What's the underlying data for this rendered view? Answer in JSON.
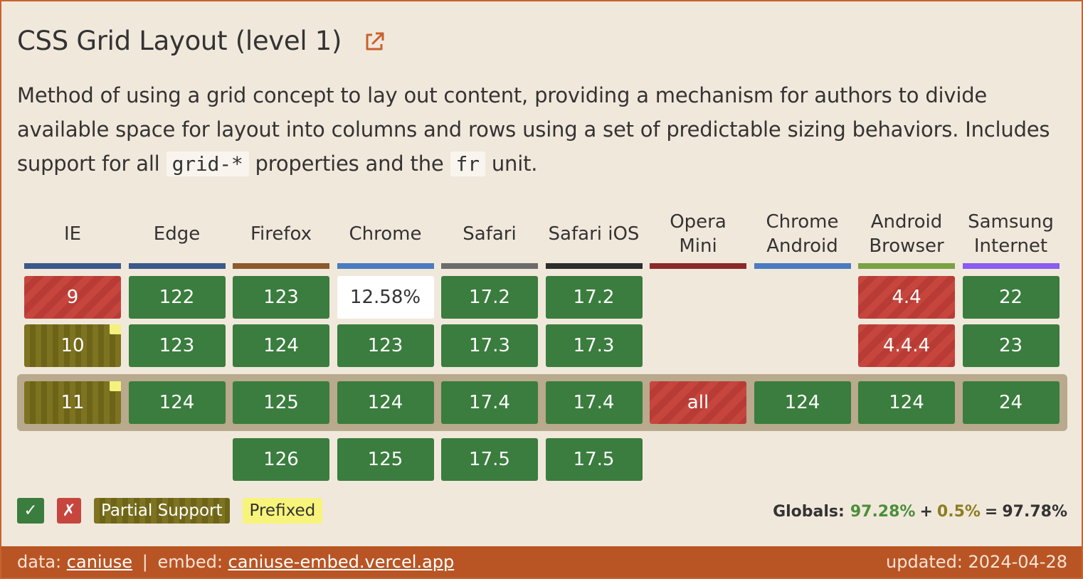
{
  "title": "CSS Grid Layout (level 1)",
  "description": {
    "part1": "Method of using a grid concept to lay out content, providing a mechanism for authors to divide available space for layout into columns and rows using a set of predictable sizing behaviors. Includes support for all ",
    "code1": "grid-*",
    "part2": " properties and the ",
    "code2": "fr",
    "part3": " unit."
  },
  "colors": {
    "supported": "#3a7d3e",
    "unsupported": "#c6463e",
    "partial": "#7d7320",
    "prefixed": "#f8f47b",
    "unknown": "#ffffff",
    "accent": "#c8622e",
    "footer": "#b95524"
  },
  "browsers": [
    {
      "name": "IE",
      "bar_color": "#3b5a8a",
      "versions": [
        {
          "label": "9",
          "status": "n"
        },
        {
          "label": "10",
          "status": "a",
          "note": true
        },
        {
          "label": "11",
          "status": "a",
          "note": true,
          "current": true
        }
      ]
    },
    {
      "name": "Edge",
      "bar_color": "#3b5a8a",
      "versions": [
        {
          "label": "122",
          "status": "y"
        },
        {
          "label": "123",
          "status": "y"
        },
        {
          "label": "124",
          "status": "y",
          "current": true
        }
      ]
    },
    {
      "name": "Firefox",
      "bar_color": "#8c5a2b",
      "versions": [
        {
          "label": "123",
          "status": "y"
        },
        {
          "label": "124",
          "status": "y"
        },
        {
          "label": "125",
          "status": "y",
          "current": true
        },
        {
          "label": "126",
          "status": "y"
        }
      ]
    },
    {
      "name": "Chrome",
      "bar_color": "#4a7cc0",
      "versions": [
        {
          "label": "12.58%",
          "status": "u"
        },
        {
          "label": "123",
          "status": "y"
        },
        {
          "label": "124",
          "status": "y",
          "current": true
        },
        {
          "label": "125",
          "status": "y"
        }
      ]
    },
    {
      "name": "Safari",
      "bar_color": "#6b6b6b",
      "versions": [
        {
          "label": "17.2",
          "status": "y"
        },
        {
          "label": "17.3",
          "status": "y"
        },
        {
          "label": "17.4",
          "status": "y",
          "current": true
        },
        {
          "label": "17.5",
          "status": "y"
        }
      ]
    },
    {
      "name": "Safari iOS",
      "bar_color": "#2d2d2d",
      "versions": [
        {
          "label": "17.2",
          "status": "y"
        },
        {
          "label": "17.3",
          "status": "y"
        },
        {
          "label": "17.4",
          "status": "y",
          "current": true
        },
        {
          "label": "17.5",
          "status": "y"
        }
      ]
    },
    {
      "name": "Opera Mini",
      "bar_color": "#8a2a2a",
      "versions": [
        {
          "label": "all",
          "status": "n",
          "current": true
        }
      ]
    },
    {
      "name": "Chrome Android",
      "bar_color": "#4a7cc0",
      "versions": [
        {
          "label": "124",
          "status": "y",
          "current": true
        }
      ]
    },
    {
      "name": "Android Browser",
      "bar_color": "#7aa143",
      "versions": [
        {
          "label": "4.4",
          "status": "n"
        },
        {
          "label": "4.4.4",
          "status": "n"
        },
        {
          "label": "124",
          "status": "y",
          "current": true
        }
      ]
    },
    {
      "name": "Samsung Internet",
      "bar_color": "#8a5cf0",
      "versions": [
        {
          "label": "22",
          "status": "y"
        },
        {
          "label": "23",
          "status": "y"
        },
        {
          "label": "24",
          "status": "y",
          "current": true
        }
      ]
    }
  ],
  "legend": {
    "supported_symbol": "✓",
    "unsupported_symbol": "✗",
    "partial_label": "Partial Support",
    "prefixed_label": "Prefixed"
  },
  "globals": {
    "label": "Globals:",
    "full": "97.28%",
    "plus": "+",
    "partial": "0.5%",
    "equals": "=",
    "total": "97.78%"
  },
  "footer": {
    "data_label": "data:",
    "data_link": "caniuse",
    "separator": "|",
    "embed_label": "embed:",
    "embed_link": "caniuse-embed.vercel.app",
    "updated": "updated: 2024-04-28"
  }
}
